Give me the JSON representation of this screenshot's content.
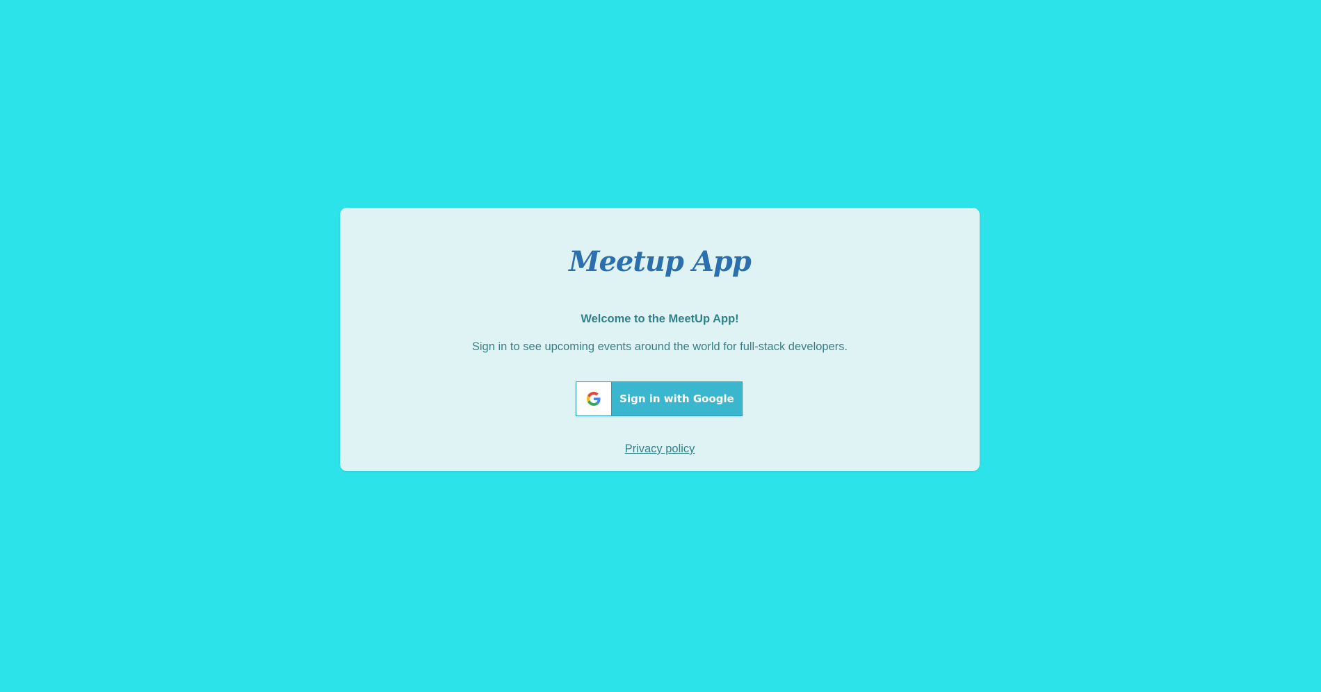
{
  "colors": {
    "background": "#2be3e9",
    "card_background": "#dff3f4",
    "title": "#2b6fae",
    "text": "#2f8189",
    "button": "#3bb6cf"
  },
  "card": {
    "app_title": "Meetup App",
    "welcome": "Welcome to the MeetUp App!",
    "subtitle": "Sign in to see upcoming events around the world for full-stack developers.",
    "google_button": {
      "label": "Sign in with Google",
      "icon": "google-g-icon"
    },
    "privacy_link": "Privacy policy"
  }
}
